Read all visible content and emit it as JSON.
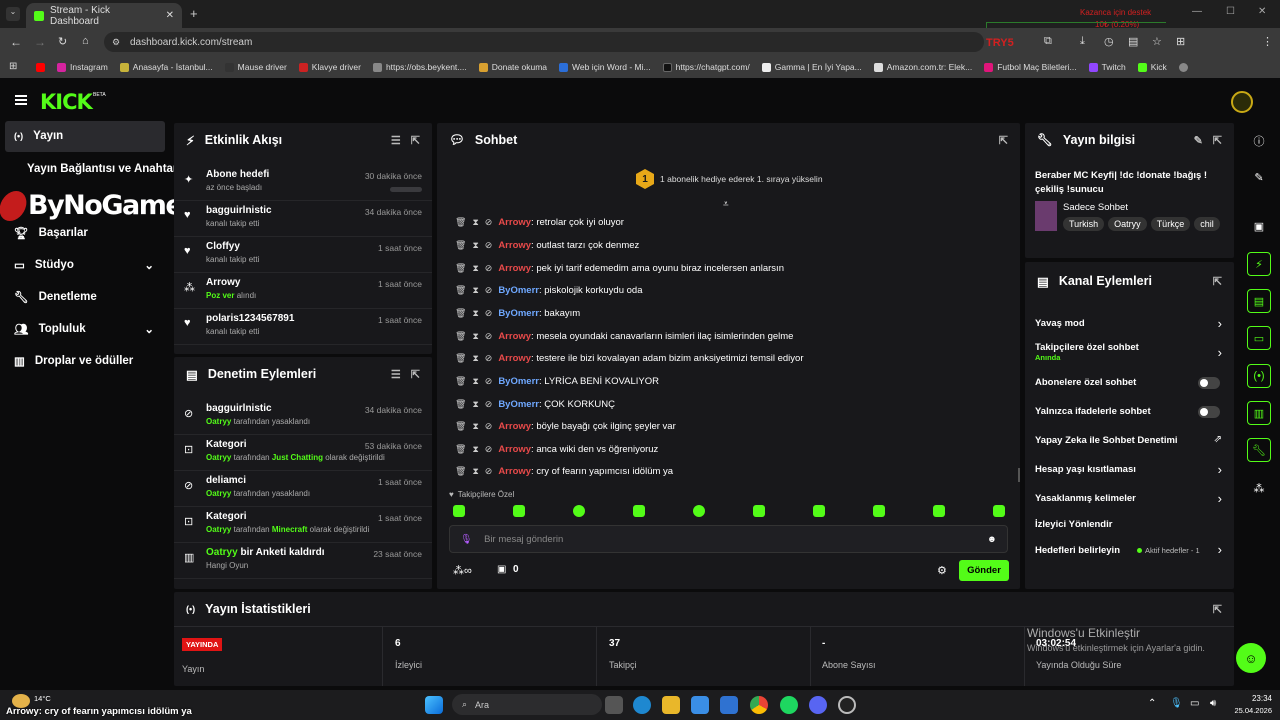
{
  "browser": {
    "tab_title": "Stream - Kick Dashboard",
    "url": "dashboard.kick.com/stream",
    "bookmarks": [
      "Instagram",
      "Anasayfa - İstanbul...",
      "Mause driver",
      "Klavye driver",
      "https://obs.beykent....",
      "Donate okuma",
      "Web için Word - Mi...",
      "https://chatgpt.com/",
      "Gamma | En İyi Yapa...",
      "Amazon.com.tr: Elek...",
      "Futbol Maç Biletleri...",
      "Twitch",
      "Kick"
    ],
    "overlay_top": "Kazanca için destek",
    "overlay_mid": "10₺ (0.20%)",
    "overlay_try": "TRY5"
  },
  "sidebar": {
    "watermark": "ByNoGame",
    "items": [
      {
        "label": "Yayın",
        "icon": "broadcast-icon"
      },
      {
        "label": "Yayın Bağlantısı ve Anahtarı",
        "icon": ""
      },
      {
        "label": "Başarılar",
        "icon": "trophy-icon"
      },
      {
        "label": "Stüdyo",
        "icon": "studio-icon"
      },
      {
        "label": "Denetleme",
        "icon": "wrench-icon"
      },
      {
        "label": "Topluluk",
        "icon": "community-icon"
      },
      {
        "label": "Droplar ve ödüller",
        "icon": "drops-icon"
      }
    ]
  },
  "activity": {
    "title": "Etkinlik Akışı",
    "events": [
      {
        "name": "Abone hedefi",
        "sub": "az önce başladı",
        "time": "30 dakika önce"
      },
      {
        "name": "bagguirlnistic",
        "sub": "kanalı takip etti",
        "time": "34 dakika önce"
      },
      {
        "name": "Cloffyy",
        "sub": "kanalı takip etti",
        "time": "1 saat önce"
      },
      {
        "name": "Arrowy",
        "sub_green": "Poz ver",
        "sub": "alındı",
        "time": "1 saat önce"
      },
      {
        "name": "polaris1234567891",
        "sub": "kanalı takip etti",
        "time": "1 saat önce"
      }
    ]
  },
  "moderation": {
    "title": "Denetim Eylemleri",
    "events": [
      {
        "name": "bagguirlnistic",
        "actor": "Oatryy",
        "sub": "tarafından yasaklandı",
        "time": "34 dakika önce"
      },
      {
        "name": "Kategori",
        "actor": "Oatryy",
        "mid": "tarafından",
        "cat": "Just Chatting",
        "sub": "olarak değiştirildi",
        "time": "53 dakika önce"
      },
      {
        "name": "deliamci",
        "actor": "Oatryy",
        "sub": "tarafından yasaklandı",
        "time": "1 saat önce"
      },
      {
        "name": "Kategori",
        "actor": "Oatryy",
        "mid": "tarafından",
        "cat": "Minecraft",
        "sub": "olarak değiştirildi",
        "time": "1 saat önce"
      },
      {
        "name_green": "Oatryy",
        "name": "bir Anketi kaldırdı",
        "sub": "Hangi Oyun",
        "time": "23 saat önce"
      }
    ]
  },
  "chat": {
    "title": "Sohbet",
    "promo_badge": "1",
    "promo": "1 abonelik hediye ederek 1. sıraya yükselin",
    "messages": [
      {
        "user": "Arrowy",
        "color": "red",
        "text": ": retrolar çok iyi oluyor"
      },
      {
        "user": "Arrowy",
        "color": "red",
        "text": ": outlast tarzı çok denmez"
      },
      {
        "user": "Arrowy",
        "color": "red",
        "text": ": pek iyi tarif edemedim ama oyunu biraz incelersen anlarsın"
      },
      {
        "user": "ByOmerr",
        "color": "blue",
        "text": ": piskolojik korkuydu oda"
      },
      {
        "user": "ByOmerr",
        "color": "blue",
        "text": ": bakayım"
      },
      {
        "user": "Arrowy",
        "color": "red",
        "text": ": mesela oyundaki canavarların isimleri ilaç isimlerinden gelme"
      },
      {
        "user": "Arrowy",
        "color": "red",
        "text": ": testere ile bizi kovalayan adam bizim anksiyetimizi temsil ediyor"
      },
      {
        "user": "ByOmerr",
        "color": "blue",
        "text": ": LYRİCA BENİ KOVALIYOR"
      },
      {
        "user": "ByOmerr",
        "color": "blue",
        "text": ": ÇOK KORKUNÇ"
      },
      {
        "user": "Arrowy",
        "color": "red",
        "text": ": böyle bayağı çok ilginç şeyler var"
      },
      {
        "user": "Arrowy",
        "color": "red",
        "text": ": anca wiki den vs öğreniyoruz"
      },
      {
        "user": "Arrowy",
        "color": "red",
        "text": ": cry of fearın yapımcısı idölüm ya"
      }
    ],
    "followers_only": "Takipçilere Özel",
    "placeholder": "Bir mesaj gönderin",
    "points": "0",
    "send": "Gönder"
  },
  "stream_info": {
    "title": "Yayın bilgisi",
    "stream_title": "Beraber MC Keyfi| !dc !donate !bağış ! çekiliş !sunucu",
    "category": "Sadece Sohbet",
    "tags": [
      "Turkish",
      "Oatryy",
      "Türkçe",
      "chil"
    ]
  },
  "channel_actions": {
    "title": "Kanal Eylemleri",
    "items": [
      {
        "label": "Yavaş mod",
        "control": "arrow"
      },
      {
        "label": "Takipçilere özel sohbet",
        "sub": "Anında",
        "control": "arrow"
      },
      {
        "label": "Abonelere özel sohbet",
        "control": "toggle"
      },
      {
        "label": "Yalnızca ifadelerle sohbet",
        "control": "toggle"
      },
      {
        "label": "Yapay Zeka ile Sohbet Denetimi",
        "control": "external"
      },
      {
        "label": "Hesap yaşı kısıtlaması",
        "control": "arrow"
      },
      {
        "label": "Yasaklanmış kelimeler",
        "control": "arrow"
      },
      {
        "label": "İzleyici Yönlendir",
        "control": "none"
      },
      {
        "label": "Hedefleri belirleyin",
        "right": "Aktif hedefler - 1",
        "control": "arrow"
      }
    ]
  },
  "stats": {
    "title": "Yayın İstatistikleri",
    "live_badge": "YAYINDA",
    "cols": [
      {
        "value": "",
        "label": "Yayın"
      },
      {
        "value": "6",
        "label": "İzleyici"
      },
      {
        "value": "37",
        "label": "Takipçi"
      },
      {
        "value": "-",
        "label": "Abone Sayısı"
      },
      {
        "value": "03:02:54",
        "label": "Yayında Olduğu Süre"
      }
    ]
  },
  "windows": {
    "activation_title": "Windows'u Etkinleştir",
    "activation_sub": "Windows'u etkinleştirmek için Ayarlar'a gidin.",
    "weather": "14°C",
    "search": "Ara",
    "time": "23:34",
    "date": "25.04.2026",
    "overlay_bottom": "Arrowy: cry of fearın yapımcısı idölüm ya"
  }
}
